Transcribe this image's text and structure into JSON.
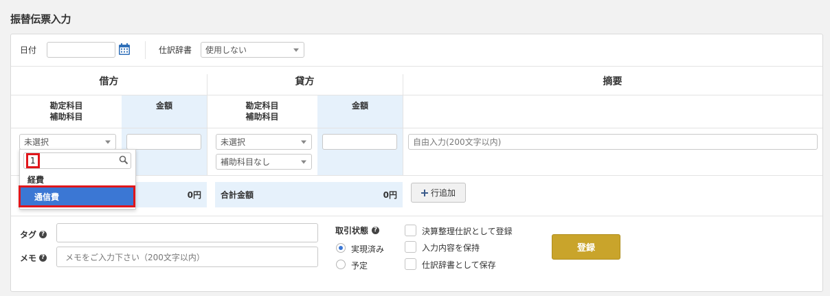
{
  "page": {
    "title": "振替伝票入力"
  },
  "filters": {
    "date_label": "日付",
    "date_value": "",
    "journal_dict_label": "仕訳辞書",
    "journal_dict_value": "使用しない"
  },
  "columns": {
    "debit": "借方",
    "credit": "貸方",
    "summary": "摘要",
    "account_line1": "勘定科目",
    "account_line2": "補助科目",
    "amount": "金額"
  },
  "row": {
    "debit_account": "未選択",
    "debit_amount": "",
    "credit_account": "未選択",
    "credit_sub_account": "補助科目なし",
    "credit_amount": "",
    "summary_placeholder": "自由入力(200文字以内)"
  },
  "dropdown": {
    "search_value": "1",
    "group_label": "経費",
    "options": [
      "通信費"
    ]
  },
  "totals": {
    "debit_amount": "0円",
    "credit_label": "合計金額",
    "credit_amount": "0円",
    "add_row_label": "行追加"
  },
  "footer": {
    "tag_label": "タグ",
    "memo_label": "メモ",
    "memo_placeholder": "メモをご入力下さい（200文字以内）",
    "status_label": "取引状態",
    "status_options": [
      "実現済み",
      "予定"
    ],
    "status_selected": "実現済み",
    "checkboxes": [
      "決算整理仕訳として登録",
      "入力内容を保持",
      "仕訳辞書として保存"
    ],
    "register_label": "登録"
  },
  "colors": {
    "accent": "#3b77d4",
    "register": "#c9a42b",
    "highlight": "#e0161b",
    "blue_column": "#e6f1fb"
  },
  "icons": [
    "calendar-icon",
    "chevron-down-icon",
    "search-icon",
    "plus-icon",
    "question-icon"
  ]
}
